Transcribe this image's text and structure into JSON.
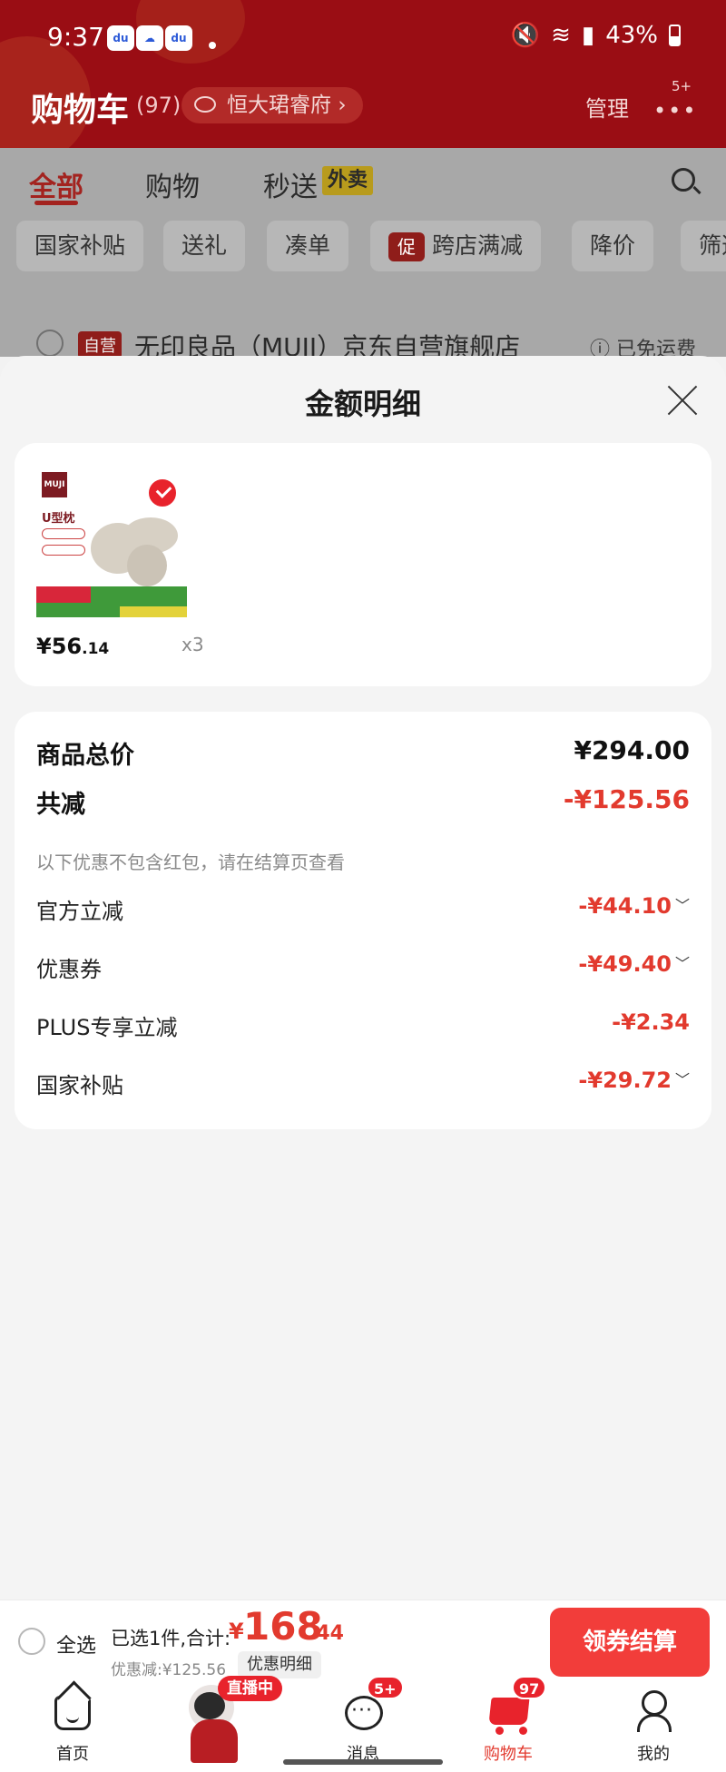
{
  "status_bar": {
    "time": "9:37",
    "battery": "43%"
  },
  "header": {
    "title": "购物车",
    "count": "(97)",
    "address": "恒大珺睿府",
    "manage_label": "管理",
    "more_badge": "5+"
  },
  "tabs": [
    {
      "label": "全部",
      "active": true
    },
    {
      "label": "购物",
      "active": false
    },
    {
      "label": "秒送",
      "active": false
    }
  ],
  "tab_badge": "外卖",
  "chips": [
    "国家补贴",
    "送礼",
    "凑单",
    "跨店满减",
    "降价",
    "筛选"
  ],
  "chip_promo_icon": "促",
  "store": {
    "tag": "自营",
    "name": "无印良品（MUJI）京东自营旗舰店",
    "shipping": "已免运费"
  },
  "sheet": {
    "title": "金额明细",
    "product": {
      "brand": "MUJI",
      "image_label": "U型枕",
      "price_main": "¥56",
      "price_cents": ".14",
      "qty": "x3"
    },
    "summary": {
      "total_label": "商品总价",
      "total_value": "¥294.00",
      "discount_label": "共减",
      "discount_value": "-¥125.56",
      "note": "以下优惠不包含红包，请在结算页查看",
      "items": [
        {
          "label": "官方立减",
          "value": "-¥44.10",
          "expandable": true
        },
        {
          "label": "优惠券",
          "value": "-¥49.40",
          "expandable": true
        },
        {
          "label": "PLUS专享立减",
          "value": "-¥2.34",
          "expandable": false
        },
        {
          "label": "国家补贴",
          "value": "-¥29.72",
          "expandable": true
        }
      ]
    }
  },
  "checkout": {
    "select_all": "全选",
    "selected_text": "已选1件,合计:",
    "total_yen": "¥",
    "total_main": "168",
    "total_cents": ".44",
    "discount_text": "优惠减:¥125.56",
    "detail_button": "优惠明细",
    "checkout_button": "领券结算"
  },
  "nav": {
    "items": [
      {
        "label": "首页",
        "icon": "home-icon"
      },
      {
        "label": "直播中",
        "icon": "live-thumbnail"
      },
      {
        "label": "消息",
        "icon": "message-icon",
        "badge": "5+"
      },
      {
        "label": "购物车",
        "icon": "cart-icon",
        "badge": "97",
        "active": true
      },
      {
        "label": "我的",
        "icon": "profile-icon"
      }
    ]
  },
  "colors": {
    "brand_red": "#e8232c",
    "header_red": "#9a0d14",
    "price_red": "#e23a2e"
  }
}
